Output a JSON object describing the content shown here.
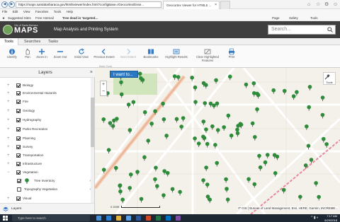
{
  "browser": {
    "url": "https://maps.santabarbaraca.gov/html5viewer/index.html?configBase=/Geocortex/Esse...",
    "tabs": [
      {
        "label": "Geocortex Viewer for HTML5 ...",
        "active": true
      },
      {
        "label": "",
        "active": false
      }
    ],
    "menu": [
      "File",
      "Edit",
      "View",
      "Favorites",
      "Tools",
      "Help"
    ],
    "favorites": [
      {
        "label": "Suggested Sites"
      },
      {
        "label": "Free Hotmail"
      },
      {
        "label": "Tree dead in 'targeted..."
      }
    ],
    "commands": [
      "Page",
      "Safety",
      "Tools"
    ]
  },
  "app": {
    "logo_city": "City of Santa Barbara",
    "logo_maps": "MAPS",
    "title": "Map Analysis and Printing System",
    "search_placeholder": "Search..."
  },
  "app_tabs": [
    "Tools",
    "Searches",
    "Tasks"
  ],
  "toolbar": {
    "tools": [
      {
        "label": "Identify",
        "icon": "identify-icon",
        "enabled": true
      },
      {
        "label": "Pan",
        "icon": "pan-icon",
        "enabled": true
      },
      {
        "label": "Zoom In",
        "icon": "zoom-in-icon",
        "enabled": true
      },
      {
        "label": "Zoom Out",
        "icon": "zoom-out-icon",
        "enabled": true
      },
      {
        "label": "Initial View",
        "icon": "initial-view-icon",
        "enabled": true
      },
      {
        "label": "Previous Extent",
        "icon": "previous-extent-icon",
        "enabled": true
      },
      {
        "label": "Next Extent",
        "icon": "next-extent-icon",
        "enabled": false
      },
      {
        "label": "Bookmarks",
        "icon": "bookmarks-icon",
        "enabled": true
      },
      {
        "label": "Highlight Results",
        "icon": "highlight-icon",
        "enabled": true
      },
      {
        "label": "Clear Highlighted Features",
        "icon": "clear-highlight-icon",
        "enabled": true
      },
      {
        "label": "Print",
        "icon": "print-icon",
        "enabled": true
      }
    ],
    "group_label": "Basic Tools"
  },
  "layers": {
    "title": "Layers",
    "items": [
      {
        "label": "Biology",
        "checked": true,
        "expanded": false
      },
      {
        "label": "Environmental Hazards",
        "checked": true,
        "expanded": false
      },
      {
        "label": "Fire",
        "checked": true,
        "expanded": false
      },
      {
        "label": "Geology",
        "checked": true,
        "expanded": false
      },
      {
        "label": "Hydrography",
        "checked": true,
        "expanded": false
      },
      {
        "label": "Parks Recreation",
        "checked": true,
        "expanded": false
      },
      {
        "label": "Planning",
        "checked": true,
        "expanded": false
      },
      {
        "label": "Survey",
        "checked": true,
        "expanded": false
      },
      {
        "label": "Transportation",
        "checked": true,
        "expanded": false
      },
      {
        "label": "Infrastructure",
        "checked": true,
        "expanded": false
      },
      {
        "label": "Vegetation",
        "checked": true,
        "expanded": true
      }
    ],
    "subitems": [
      {
        "label": "Tree Inventory",
        "checked": true
      },
      {
        "label": "Topography Vegetation",
        "checked": false
      }
    ],
    "after": [
      {
        "label": "Visual",
        "checked": true,
        "expanded": false
      }
    ],
    "footer": "Layers"
  },
  "map": {
    "i_want_to": "I want to...",
    "tools_label": "Tools",
    "scale_text": "0        200ft",
    "attribution": "IT GIS | Bureau of Land Management, Esri, HERE, Garmin, INCREME..."
  },
  "taskbar": {
    "search_placeholder": "Type here to search",
    "time": "7:17 AM",
    "date": "6/29/2018"
  },
  "colors": {
    "accent": "#2b78c2",
    "header_bg": "#3e3e3e",
    "tree_symbol": "#2e8b3a"
  }
}
